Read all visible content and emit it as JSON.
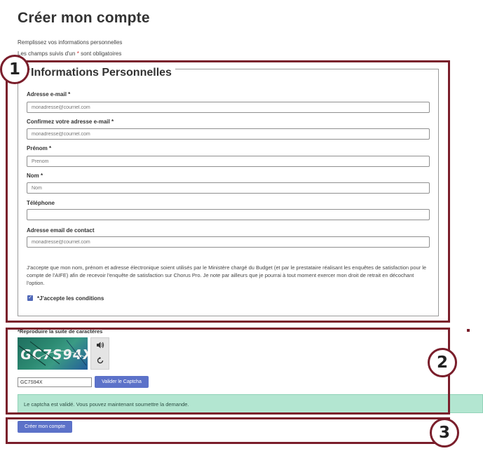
{
  "page": {
    "title": "Créer mon compte",
    "intro_line1": "Remplissez vos informations personnelles",
    "intro_line2_prefix": "Les champs suivis d'un",
    "required_mark": "*",
    "intro_line2_suffix": "sont obligatoires"
  },
  "annotations": {
    "n1": "1",
    "n2": "2",
    "n3": "3"
  },
  "form": {
    "section_title": "Informations Personnelles",
    "fields": [
      {
        "label": "Adresse e-mail",
        "required": "*",
        "placeholder": "monadresse@courriel.com",
        "value": ""
      },
      {
        "label": "Confirmez votre adresse e-mail",
        "required": "*",
        "placeholder": "monadresse@courriel.com",
        "value": ""
      },
      {
        "label": "Prénom",
        "required": "*",
        "placeholder": "Prenom",
        "value": ""
      },
      {
        "label": "Nom",
        "required": "*",
        "placeholder": "Nom",
        "value": ""
      },
      {
        "label": "Téléphone",
        "required": "",
        "placeholder": "",
        "value": ""
      },
      {
        "label": "Adresse email de contact",
        "required": "",
        "placeholder": "monadresse@courriel.com",
        "value": ""
      }
    ],
    "consent_text": "J'accepte que mon nom, prénom et adresse électronique soient utilisés par le Ministère chargé du Budget (et par le prestataire réalisant les enquêtes de satisfaction pour le compte de l'AIFE) afin de recevoir l'enquête de satisfaction sur Chorus Pro. Je note par ailleurs que je pourrai à tout moment exercer mon droit de retrait en décochant l'option.",
    "accept_label": "*J'accepte les conditions",
    "accept_checked": true
  },
  "captcha": {
    "label": "*Reproduire la suite de caractères",
    "image_text": "GC7S94X",
    "audio_icon": "speaker-icon",
    "refresh_icon": "refresh-icon",
    "input_value": "GC7S94X",
    "validate_label": "Valider le Captcha",
    "success_message": "Le captcha est validé. Vous pouvez maintenant soumettre la demande."
  },
  "actions": {
    "create_label": "Créer mon compte"
  },
  "colors": {
    "annotation": "#7a1e2b",
    "primary_button": "#5c72c9",
    "success_bg": "#b3e6d1",
    "required": "#d32f2f"
  }
}
